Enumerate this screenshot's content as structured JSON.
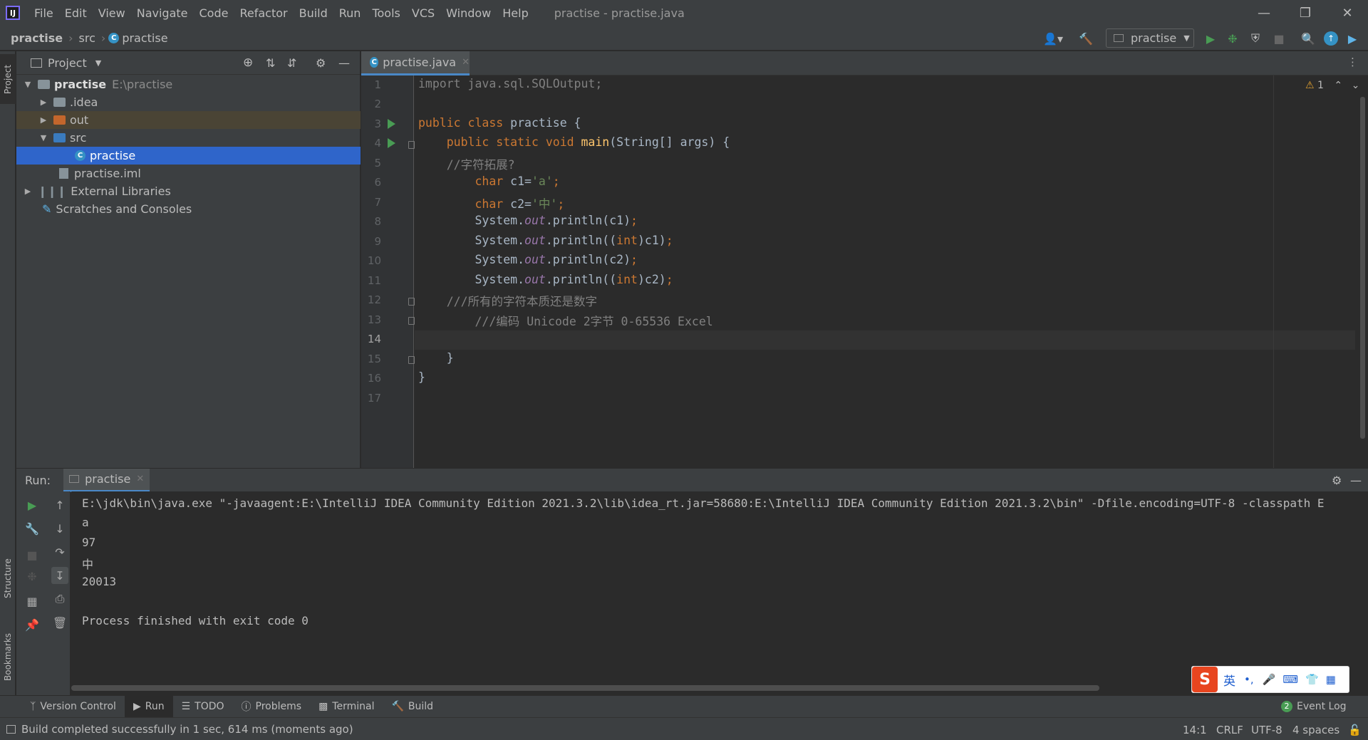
{
  "app": {
    "logo_text": "IJ",
    "window_title": "practise - practise.java"
  },
  "menu": [
    "File",
    "Edit",
    "View",
    "Navigate",
    "Code",
    "Refactor",
    "Build",
    "Run",
    "Tools",
    "VCS",
    "Window",
    "Help"
  ],
  "breadcrumb": {
    "project": "practise",
    "folder": "src",
    "file": "practise"
  },
  "run_config": {
    "label": "practise"
  },
  "left_stripe": {
    "project_tab": "Project",
    "structure_tab": "Structure",
    "bookmarks_tab": "Bookmarks"
  },
  "project_panel": {
    "title": "Project",
    "tree": [
      {
        "label": "practise",
        "hint": "E:\\practise"
      },
      {
        "label": ".idea"
      },
      {
        "label": "out"
      },
      {
        "label": "src"
      },
      {
        "label": "practise"
      },
      {
        "label": "practise.iml"
      },
      {
        "label": "External Libraries"
      },
      {
        "label": "Scratches and Consoles"
      }
    ]
  },
  "editor": {
    "tab_label": "practise.java",
    "warning_count": "1",
    "line_numbers": [
      "1",
      "2",
      "3",
      "4",
      "5",
      "6",
      "7",
      "8",
      "9",
      "10",
      "11",
      "12",
      "13",
      "14",
      "15",
      "16",
      "17"
    ],
    "current_line": "14"
  },
  "run_panel": {
    "run_label": "Run:",
    "tab_label": "practise",
    "console": [
      "E:\\jdk\\bin\\java.exe \"-javaagent:E:\\IntelliJ IDEA Community Edition 2021.3.2\\lib\\idea_rt.jar=58680:E:\\IntelliJ IDEA Community Edition 2021.3.2\\bin\" -Dfile.encoding=UTF-8 -classpath E",
      "a",
      "97",
      "中",
      "20013",
      "",
      "Process finished with exit code 0"
    ]
  },
  "bottom_tabs": [
    "Version Control",
    "Run",
    "TODO",
    "Problems",
    "Terminal",
    "Build"
  ],
  "event_log": {
    "count": "2",
    "label": "Event Log"
  },
  "status": {
    "message": "Build completed successfully in 1 sec, 614 ms (moments ago)",
    "position": "14:1",
    "line_sep": "CRLF",
    "encoding": "UTF-8",
    "indent": "4 spaces"
  },
  "ime": {
    "mode": "英"
  }
}
